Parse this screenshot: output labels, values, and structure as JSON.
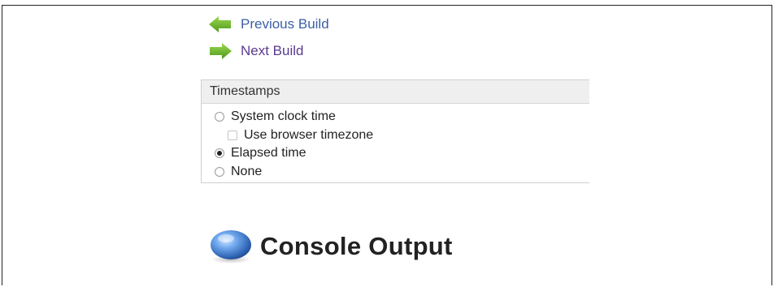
{
  "nav": {
    "previous_build": "Previous Build",
    "next_build": "Next Build",
    "previous_icon": "green-left-arrow-icon",
    "next_icon": "green-right-arrow-icon"
  },
  "timestamps": {
    "header": "Timestamps",
    "options": [
      {
        "label": "System clock time",
        "type": "radio",
        "checked": false
      },
      {
        "label": "Use browser timezone",
        "type": "checkbox",
        "checked": false
      },
      {
        "label": "Elapsed time",
        "type": "radio",
        "checked": true
      },
      {
        "label": "None",
        "type": "radio",
        "checked": false
      }
    ]
  },
  "console": {
    "title": "Console Output",
    "icon": "blue-orb-icon"
  },
  "colors": {
    "link_blue": "#3b5fa5",
    "link_visited": "#5a3a8f",
    "arrow_green": "#6abf2a",
    "orb_blue": "#2f6fc1",
    "panel_header_bg": "#efefef"
  }
}
